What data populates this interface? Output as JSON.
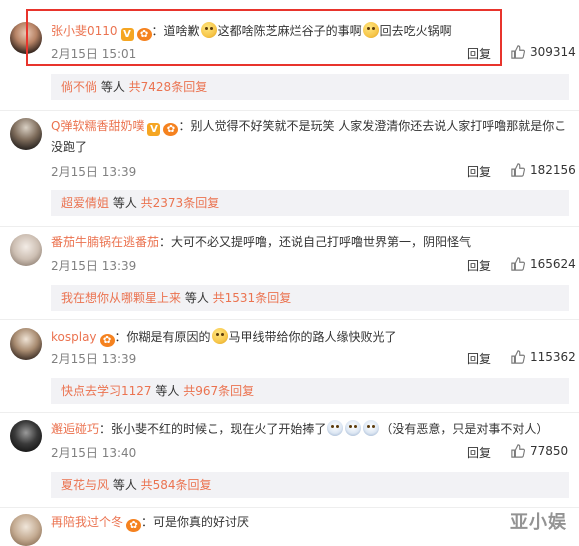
{
  "accent_color": "#eb7350",
  "highlight_color": "#e8342c",
  "comments": [
    {
      "username": "张小斐0110",
      "badges": [
        "v-badge",
        "vip-badge"
      ],
      "text_parts": [
        "：道啥歉",
        "这都啥陈芝麻烂谷子的事啊",
        "回去吃火锅啊"
      ],
      "date": "2月15日 15:01",
      "reply_label": "回复",
      "likes": "309314",
      "sub_user": "倘不倘",
      "sub_mid": " 等人 ",
      "sub_count": "共7428条回复"
    },
    {
      "username": "Q弹软糯香甜奶噗",
      "badges": [
        "v-badge",
        "vip-badge"
      ],
      "text_line1": "：别人觉得不好笑就不是玩笑 人家发澄清你还去说人家打呼噜那就是你こ",
      "text_line2": "没跑了",
      "date": "2月15日 13:39",
      "reply_label": "回复",
      "likes": "182156",
      "sub_user": "超爱倩姐",
      "sub_mid": " 等人 ",
      "sub_count": "共2373条回复"
    },
    {
      "username": "番茄牛腩锅在逃番茄",
      "text": "：大可不必又提呼噜，还说自己打呼噜世界第一，阴阳怪气",
      "date": "2月15日 13:39",
      "reply_label": "回复",
      "likes": "165624",
      "sub_user": "我在想你从哪颗星上来",
      "sub_mid": " 等人 ",
      "sub_count": "共1531条回复"
    },
    {
      "username": "kosplay",
      "badges": [
        "vip-badge"
      ],
      "text_parts": [
        "：你糊是有原因的",
        "马甲线带给你的路人缘快败光了"
      ],
      "date": "2月15日 13:39",
      "reply_label": "回复",
      "likes": "115362",
      "sub_user": "快点去学习1127",
      "sub_mid": " 等人 ",
      "sub_count": "共967条回复"
    },
    {
      "username": "邂逅碰巧",
      "text_parts": [
        "：张小斐不红的时候こ，现在火了开始捧了",
        "（没有恶意，只是对事不对人）"
      ],
      "date": "2月15日 13:40",
      "reply_label": "回复",
      "likes": "77850",
      "sub_user": "夏花与风",
      "sub_mid": " 等人 ",
      "sub_count": "共584条回复"
    },
    {
      "username": "再陪我过个冬",
      "badges": [
        "vip-badge"
      ],
      "text": "：可是你真的好讨厌"
    }
  ],
  "watermark": "亚小娱",
  "icons": {
    "like": "thumbs-up-icon",
    "badge_v": "v-badge-icon",
    "badge_vip": "vip-badge-icon"
  }
}
